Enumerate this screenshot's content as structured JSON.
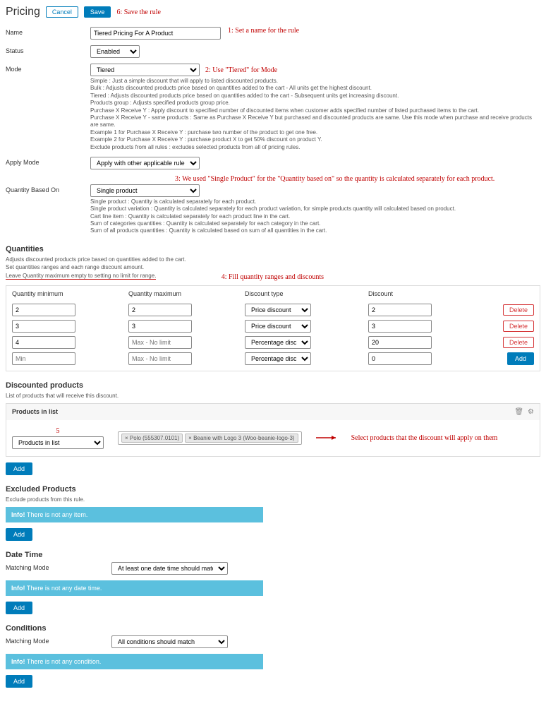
{
  "header": {
    "title": "Pricing",
    "cancel": "Cancel",
    "save": "Save"
  },
  "annotations": {
    "a1": "1: Set a name for the rule",
    "a2": "2: Use \"Tiered\" for Mode",
    "a3": "3: We used \"Single Product\" for the \"Quantity based on\" so the quantity is calculated separately for each product.",
    "a4": "4: Fill quantity ranges and discounts",
    "a5": "5",
    "a6": "6: Save the rule",
    "aProducts": "Select products that the discount will apply on them"
  },
  "fields": {
    "name_label": "Name",
    "name_value": "Tiered Pricing For A Product",
    "status_label": "Status",
    "status_value": "Enabled",
    "mode_label": "Mode",
    "mode_value": "Tiered",
    "mode_help": [
      "Simple : Just a simple discount that will apply to listed discounted products.",
      "Bulk : Adjusts discounted products price based on quantities added to the cart - All units get the highest discount.",
      "Tiered : Adjusts discounted products price based on quantities added to the cart - Subsequent units get increasing discount.",
      "Products group : Adjusts specified products group price.",
      "Purchase X Receive Y : Apply discount to specified number of discounted items when customer adds specified number of listed purchased items to the cart.",
      "Purchase X Receive Y - same products : Same as Purchase X Receive Y but purchased and discounted products are same. Use this mode when purchase and receive products are same.",
      "Example 1 for Purchase X Receive Y : purchase two number of the product to get one free.",
      "Example 2 for Purchase X Receive Y : purchase product X to get 50% discount on product Y.",
      "Exclude products from all rules : excludes selected products from all of pricing rules."
    ],
    "applymode_label": "Apply Mode",
    "applymode_value": "Apply with other applicable rules",
    "qbasedon_label": "Quantity Based On",
    "qbasedon_value": "Single product",
    "qbasedon_help": [
      "Single product : Quantity is calculated separately for each product.",
      "Single product variation : Quantity is calculated separately for each product variation, for simple products quantity will calculated based on product.",
      "Cart line item : Quantity is calculated separately for each product line in the cart.",
      "Sum of categories quantities : Quantity is calculated separately for each category in the cart.",
      "Sum of all products quantities : Quantity is calculated based on sum of all quantities in the cart."
    ]
  },
  "quantities": {
    "title": "Quantities",
    "help": [
      "Adjusts discounted products price based on quantities added to the cart.",
      "Set quantities ranges and each range discount amount.",
      "Leave Quantity maximum empty to setting no limit for range."
    ],
    "cols": {
      "min": "Quantity minimum",
      "max": "Quantity maximum",
      "type": "Discount type",
      "disc": "Discount"
    },
    "rows": [
      {
        "min": "2",
        "max": "2",
        "type": "Price discount",
        "disc": "2",
        "del": "Delete"
      },
      {
        "min": "3",
        "max": "3",
        "type": "Price discount",
        "disc": "3",
        "del": "Delete"
      },
      {
        "min": "4",
        "max": "",
        "maxph": "Max - No limit",
        "type": "Percentage discount",
        "disc": "20",
        "del": "Delete"
      },
      {
        "min": "",
        "minph": "Min",
        "max": "",
        "maxph": "Max - No limit",
        "type": "Percentage discount",
        "disc": "0",
        "del": "Add",
        "isAdd": true
      }
    ]
  },
  "discounted": {
    "title": "Discounted products",
    "help": "List of products that will receive this discount.",
    "panel_title": "Products in list",
    "select_value": "Products in list",
    "tags": [
      "× Polo (555307.0101)",
      "× Beanie with Logo 3 (Woo-beanie-logo-3)"
    ],
    "add": "Add"
  },
  "excluded": {
    "title": "Excluded Products",
    "help": "Exclude products from this rule.",
    "info_label": "Info!",
    "info_text": " There is not any item.",
    "add": "Add"
  },
  "datetime": {
    "title": "Date Time",
    "match_label": "Matching Mode",
    "match_value": "At least one date time should match",
    "info_label": "Info!",
    "info_text": " There is not any date time.",
    "add": "Add"
  },
  "conditions": {
    "title": "Conditions",
    "match_label": "Matching Mode",
    "match_value": "All conditions should match",
    "info_label": "Info!",
    "info_text": " There is not any condition.",
    "add": "Add"
  }
}
